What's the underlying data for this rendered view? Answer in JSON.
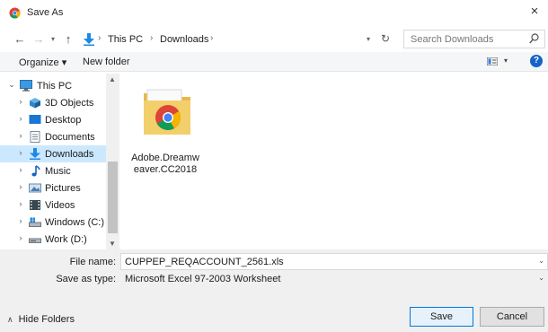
{
  "window": {
    "title": "Save As",
    "close_label": "×"
  },
  "address": {
    "crumbs": [
      "This PC",
      "Downloads"
    ],
    "separator": "›",
    "search_placeholder": "Search Downloads"
  },
  "toolbar": {
    "organize_label": "Organize ▾",
    "new_folder_label": "New folder",
    "help_label": "?"
  },
  "navigation": {
    "items": [
      {
        "label": "This PC",
        "icon": "monitor-icon",
        "expanded": true
      },
      {
        "label": "3D Objects",
        "icon": "3d-objects-icon"
      },
      {
        "label": "Desktop",
        "icon": "desktop-icon"
      },
      {
        "label": "Documents",
        "icon": "documents-icon"
      },
      {
        "label": "Downloads",
        "icon": "downloads-icon",
        "selected": true
      },
      {
        "label": "Music",
        "icon": "music-icon"
      },
      {
        "label": "Pictures",
        "icon": "pictures-icon"
      },
      {
        "label": "Videos",
        "icon": "videos-icon"
      },
      {
        "label": "Windows (C:)",
        "icon": "drive-c-icon"
      },
      {
        "label": "Work (D:)",
        "icon": "drive-d-icon"
      }
    ]
  },
  "files": [
    {
      "name": "Adobe.Dreamweaver.CC2018",
      "icon": "chrome-folder-icon"
    }
  ],
  "form": {
    "file_name_label": "File name:",
    "file_name_value": "CUPPEP_REQACCOUNT_2561.xls",
    "save_type_label": "Save as type:",
    "save_type_value": "Microsoft Excel 97-2003 Worksheet"
  },
  "footer": {
    "hide_folders_label": "Hide Folders",
    "save_label": "Save",
    "cancel_label": "Cancel"
  },
  "colors": {
    "selection": "#cce8ff",
    "accent": "#0078d7",
    "help": "#1464c8"
  }
}
